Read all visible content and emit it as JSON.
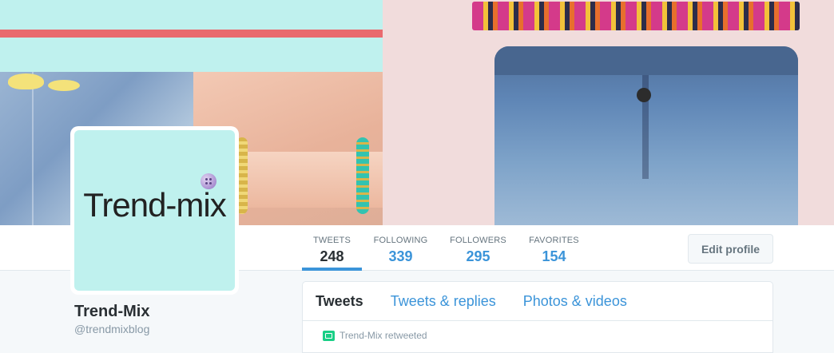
{
  "profile": {
    "avatar_text": "Trend-mix",
    "name": "Trend-Mix",
    "handle": "@trendmixblog"
  },
  "stats": [
    {
      "label": "TWEETS",
      "value": "248"
    },
    {
      "label": "FOLLOWING",
      "value": "339"
    },
    {
      "label": "FOLLOWERS",
      "value": "295"
    },
    {
      "label": "FAVORITES",
      "value": "154"
    }
  ],
  "actions": {
    "edit_profile": "Edit profile"
  },
  "timeline": {
    "tabs": [
      "Tweets",
      "Tweets & replies",
      "Photos & videos"
    ],
    "retweet_notice": "Trend-Mix retweeted"
  },
  "colors": {
    "accent": "#3b94d9",
    "retweet": "#19cf86",
    "banner_mint": "#bff1ee"
  },
  "icons": {
    "avatar_button": "button-icon",
    "retweet": "retweet-icon"
  }
}
